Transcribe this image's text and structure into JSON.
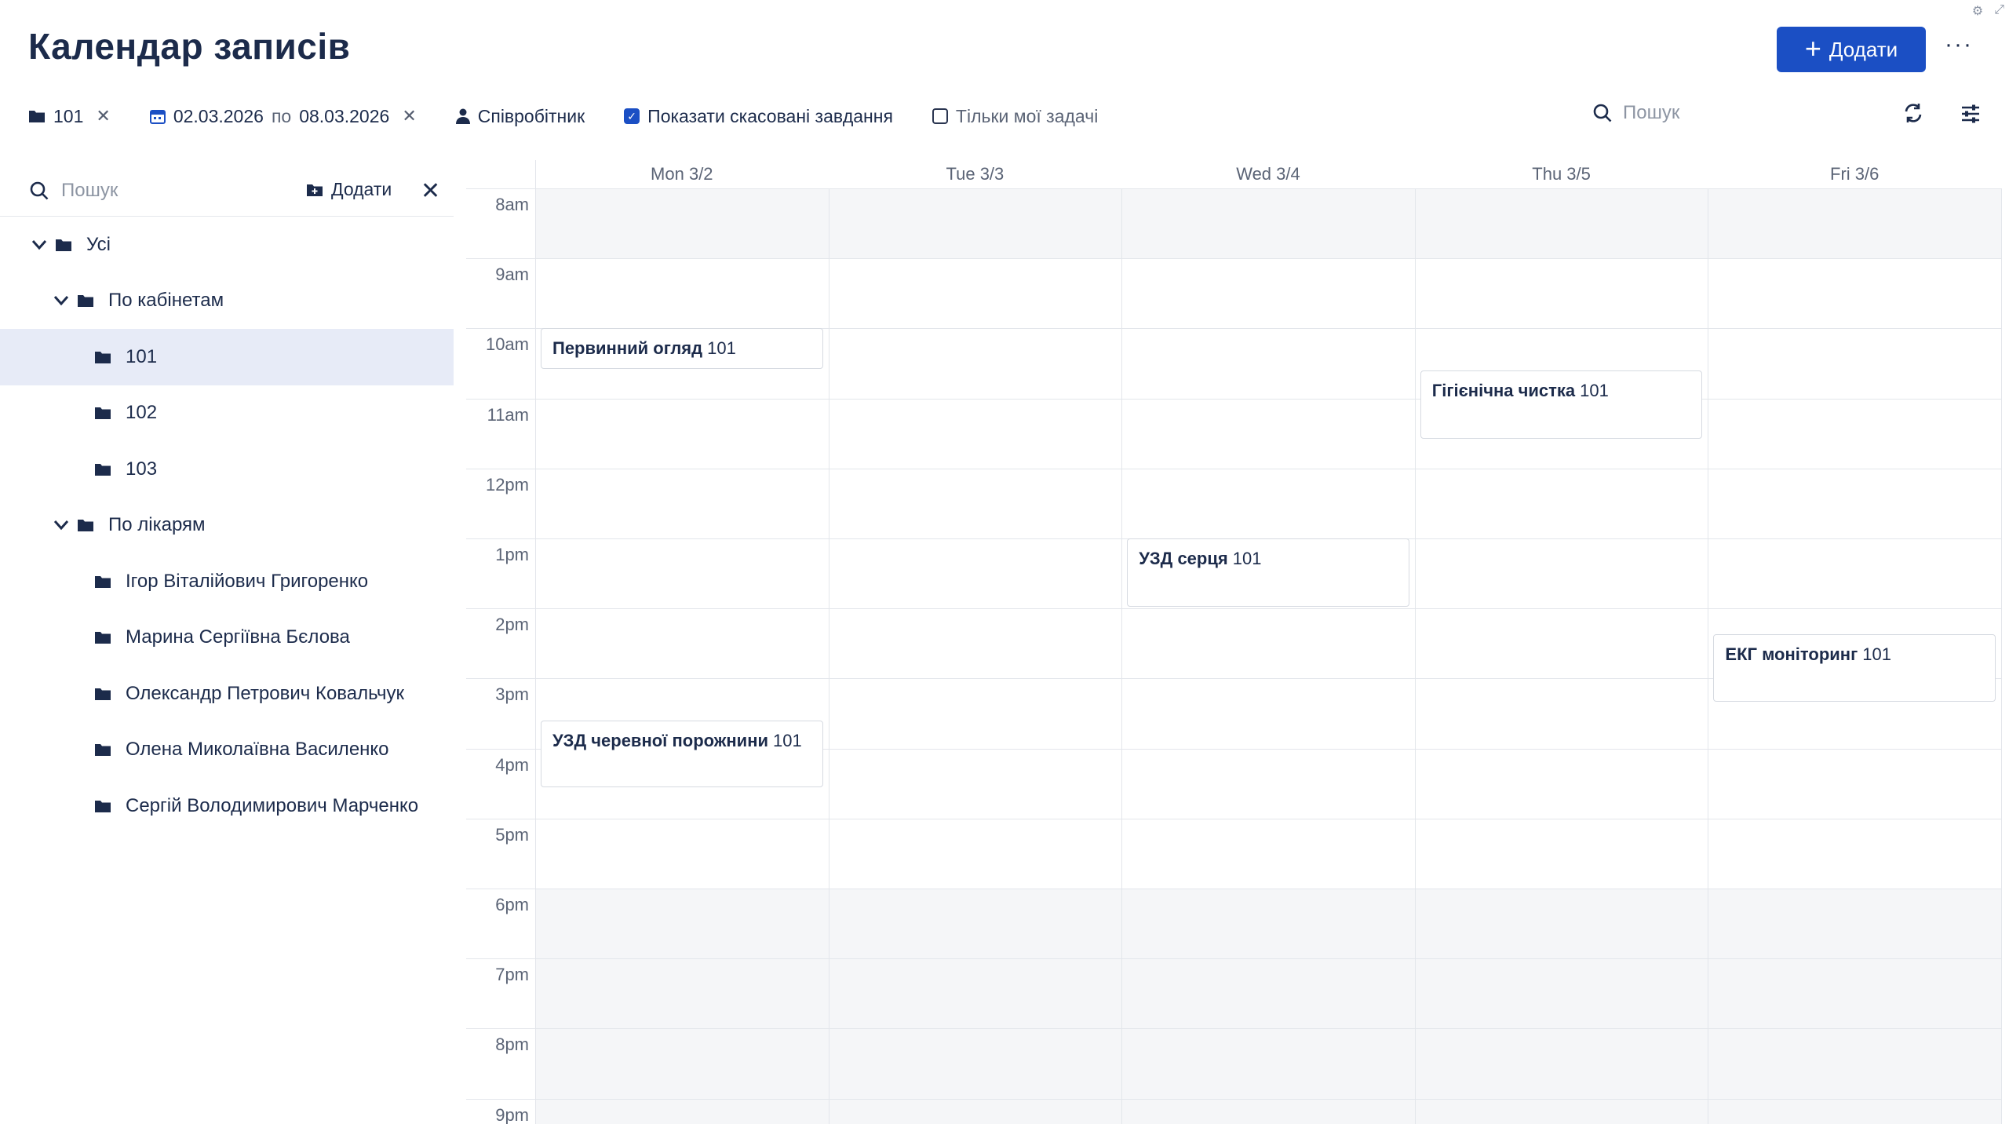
{
  "page": {
    "title": "Календар записів",
    "add_label": "Додати",
    "more_label": "···"
  },
  "filters": {
    "room": "101",
    "date_from": "02.03.2026",
    "date_sep": "по",
    "date_to": "08.03.2026",
    "employee": "Співробітник",
    "show_cancelled": "Показати скасовані завдання",
    "show_cancelled_checked": true,
    "only_mine": "Тільки мої задачі",
    "only_mine_checked": false,
    "search_placeholder": "Пошук"
  },
  "sidebar": {
    "search_placeholder": "Пошук",
    "add_label": "Додати",
    "tree": [
      {
        "label": "Усі",
        "level": 0,
        "expandable": true,
        "selected": false
      },
      {
        "label": "По кабінетам",
        "level": 1,
        "expandable": true,
        "selected": false
      },
      {
        "label": "101",
        "level": 2,
        "expandable": false,
        "selected": true
      },
      {
        "label": "102",
        "level": 2,
        "expandable": false,
        "selected": false
      },
      {
        "label": "103",
        "level": 2,
        "expandable": false,
        "selected": false
      },
      {
        "label": "По лікарям",
        "level": 1,
        "expandable": true,
        "selected": false
      },
      {
        "label": "Ігор Віталійович Григоренко",
        "level": 2,
        "expandable": false,
        "selected": false
      },
      {
        "label": "Марина Сергіївна Бєлова",
        "level": 2,
        "expandable": false,
        "selected": false
      },
      {
        "label": "Олександр Петрович Ковальчук",
        "level": 2,
        "expandable": false,
        "selected": false
      },
      {
        "label": "Олена Миколаївна Василенко",
        "level": 2,
        "expandable": false,
        "selected": false
      },
      {
        "label": "Сергій Володимирович Марченко",
        "level": 2,
        "expandable": false,
        "selected": false
      }
    ]
  },
  "calendar": {
    "days": [
      "Mon 3/2",
      "Tue 3/3",
      "Wed 3/4",
      "Thu 3/5",
      "Fri 3/6"
    ],
    "hours": [
      "8am",
      "9am",
      "10am",
      "11am",
      "12pm",
      "1pm",
      "2pm",
      "3pm",
      "4pm",
      "5pm",
      "6pm",
      "7pm",
      "8pm",
      "9pm"
    ],
    "events": [
      {
        "title": "Первинний огляд",
        "room": "101",
        "day": 0,
        "start": 10.0,
        "end": 10.58
      },
      {
        "title": "Гігієнічна чистка",
        "room": "101",
        "day": 3,
        "start": 10.6,
        "end": 11.58
      },
      {
        "title": "УЗД серця",
        "room": "101",
        "day": 2,
        "start": 13.0,
        "end": 13.97
      },
      {
        "title": "ЕКГ моніторинг",
        "room": "101",
        "day": 4,
        "start": 14.37,
        "end": 15.33
      },
      {
        "title": "УЗД черевної порожнини",
        "room": "101",
        "day": 0,
        "start": 15.6,
        "end": 16.55
      }
    ]
  }
}
